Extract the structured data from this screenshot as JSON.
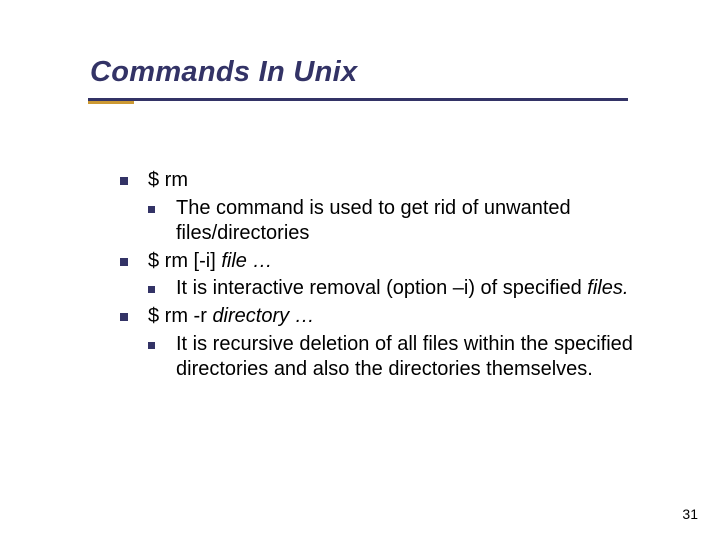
{
  "slide": {
    "title": "Commands In Unix",
    "page_number": "31"
  },
  "content": {
    "b1_1": "$ rm",
    "b1_1_s1": "The command is used to get rid of unwanted files/directories",
    "b1_2_pre": "$ rm [-i] ",
    "b1_2_ital": "file …",
    "b1_2_s1_pre": "It is interactive removal (option –i) of specified ",
    "b1_2_s1_ital": "files.",
    "b1_3_pre": "$ rm -r ",
    "b1_3_ital": "directory …",
    "b1_3_s1": "It is recursive deletion of all files within the specified directories and also the directories themselves."
  }
}
